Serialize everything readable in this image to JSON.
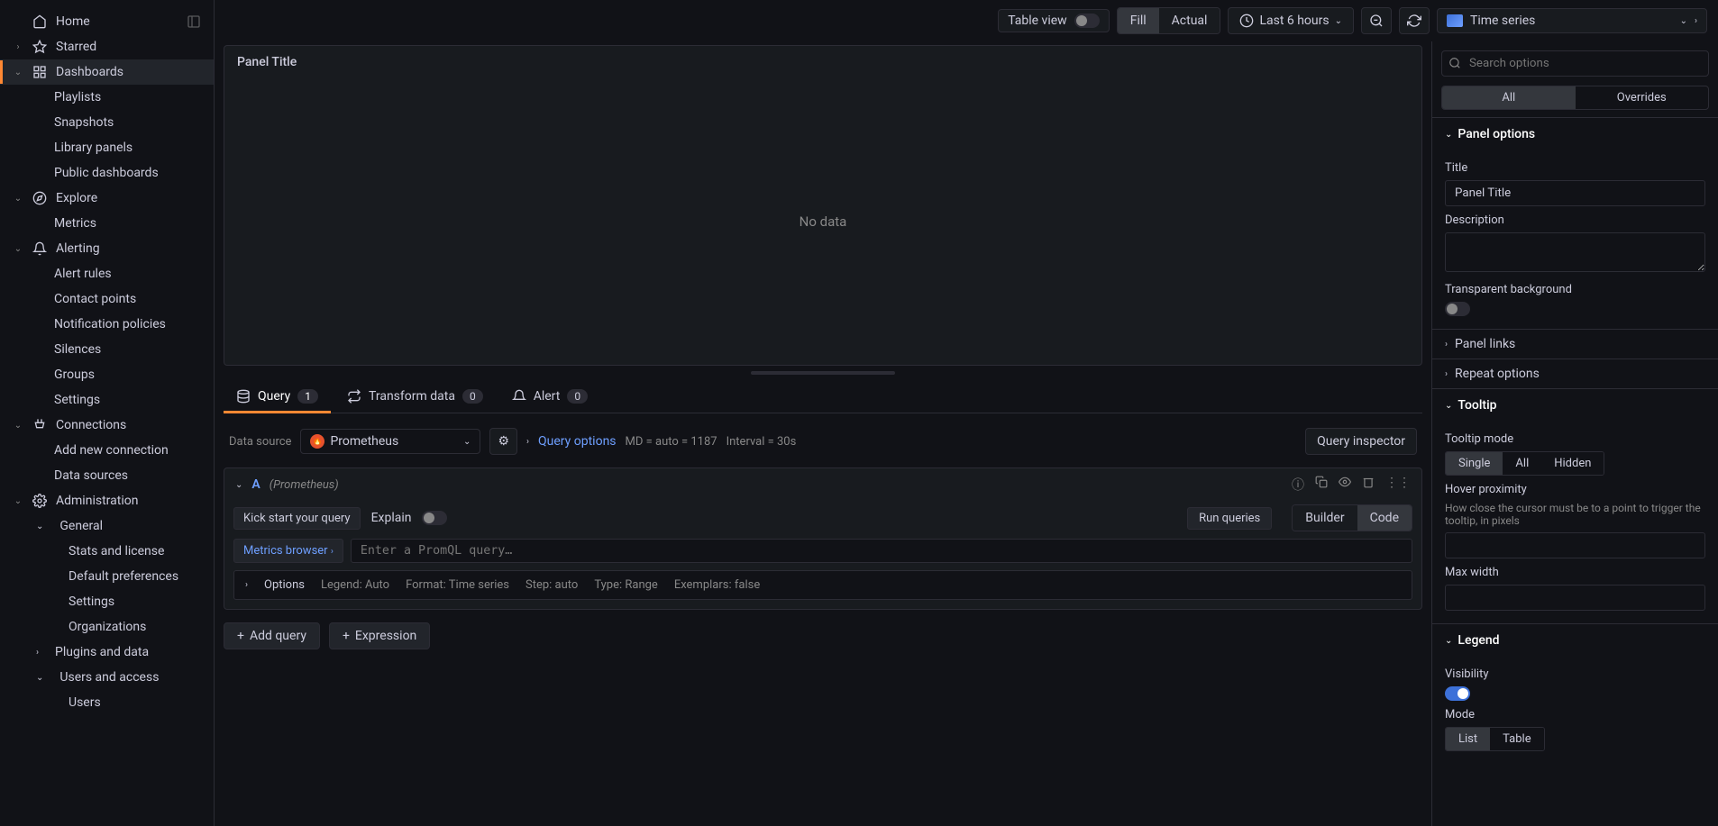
{
  "sidebar": {
    "items": [
      {
        "label": "Home",
        "icon": "home"
      },
      {
        "label": "Starred",
        "icon": "star"
      },
      {
        "label": "Dashboards",
        "icon": "dashboard",
        "active": true
      },
      {
        "label": "Playlists"
      },
      {
        "label": "Snapshots"
      },
      {
        "label": "Library panels"
      },
      {
        "label": "Public dashboards"
      },
      {
        "label": "Explore",
        "icon": "compass"
      },
      {
        "label": "Metrics"
      },
      {
        "label": "Alerting",
        "icon": "bell"
      },
      {
        "label": "Alert rules"
      },
      {
        "label": "Contact points"
      },
      {
        "label": "Notification policies"
      },
      {
        "label": "Silences"
      },
      {
        "label": "Groups"
      },
      {
        "label": "Settings"
      },
      {
        "label": "Connections",
        "icon": "plug"
      },
      {
        "label": "Add new connection"
      },
      {
        "label": "Data sources"
      },
      {
        "label": "Administration",
        "icon": "gear"
      },
      {
        "label": "General"
      },
      {
        "label": "Stats and license"
      },
      {
        "label": "Default preferences"
      },
      {
        "label": "Settings"
      },
      {
        "label": "Organizations"
      },
      {
        "label": "Plugins and data"
      },
      {
        "label": "Users and access"
      },
      {
        "label": "Users"
      }
    ]
  },
  "toolbar": {
    "tableView": "Table view",
    "fill": "Fill",
    "actual": "Actual",
    "timeRange": "Last 6 hours",
    "vizType": "Time series"
  },
  "panel": {
    "title": "Panel Title",
    "noData": "No data"
  },
  "tabs": {
    "query": "Query",
    "queryCount": "1",
    "transform": "Transform data",
    "transformCount": "0",
    "alert": "Alert",
    "alertCount": "0"
  },
  "queryBar": {
    "dataSourceLabel": "Data source",
    "dataSource": "Prometheus",
    "queryOptions": "Query options",
    "md": "MD = auto = 1187",
    "interval": "Interval = 30s",
    "inspector": "Query inspector"
  },
  "queryCard": {
    "letter": "A",
    "ds": "(Prometheus)",
    "kickStart": "Kick start your query",
    "explain": "Explain",
    "run": "Run queries",
    "builder": "Builder",
    "code": "Code",
    "metricsBrowser": "Metrics browser",
    "placeholder": "Enter a PromQL query…",
    "options": "Options",
    "legend": "Legend: Auto",
    "format": "Format: Time series",
    "step": "Step: auto",
    "type": "Type: Range",
    "exemplars": "Exemplars: false"
  },
  "actions": {
    "addQuery": "Add query",
    "expression": "Expression"
  },
  "rightPanel": {
    "searchPlaceholder": "Search options",
    "all": "All",
    "overrides": "Overrides",
    "panelOptions": "Panel options",
    "titleLabel": "Title",
    "titleValue": "Panel Title",
    "descLabel": "Description",
    "transparentBg": "Transparent background",
    "panelLinks": "Panel links",
    "repeatOptions": "Repeat options",
    "tooltip": "Tooltip",
    "tooltipMode": "Tooltip mode",
    "single": "Single",
    "tAll": "All",
    "hidden": "Hidden",
    "hoverProx": "Hover proximity",
    "hoverDesc": "How close the cursor must be to a point to trigger the tooltip, in pixels",
    "maxWidth": "Max width",
    "legend": "Legend",
    "visibility": "Visibility",
    "mode": "Mode",
    "list": "List",
    "table": "Table"
  }
}
